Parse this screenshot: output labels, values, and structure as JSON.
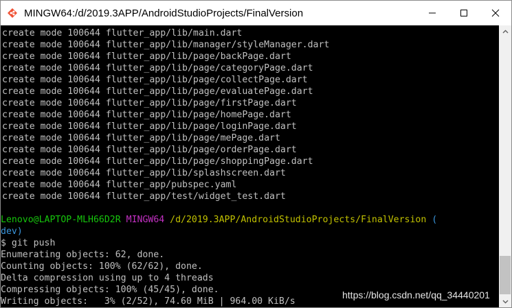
{
  "window": {
    "title": "MINGW64:/d/2019.3APP/AndroidStudioProjects/FinalVersion",
    "icon": "mingw-terminal-icon"
  },
  "controls": {
    "minimize_icon": "minimize-icon",
    "maximize_icon": "maximize-icon",
    "close_icon": "close-icon"
  },
  "terminal": {
    "create_lines": [
      "create mode 100644 flutter_app/lib/main.dart",
      "create mode 100644 flutter_app/lib/manager/styleManager.dart",
      "create mode 100644 flutter_app/lib/page/backPage.dart",
      "create mode 100644 flutter_app/lib/page/categoryPage.dart",
      "create mode 100644 flutter_app/lib/page/collectPage.dart",
      "create mode 100644 flutter_app/lib/page/evaluatePage.dart",
      "create mode 100644 flutter_app/lib/page/firstPage.dart",
      "create mode 100644 flutter_app/lib/page/homePage.dart",
      "create mode 100644 flutter_app/lib/page/loginPage.dart",
      "create mode 100644 flutter_app/lib/page/mePage.dart",
      "create mode 100644 flutter_app/lib/page/orderPage.dart",
      "create mode 100644 flutter_app/lib/page/shoppingPage.dart",
      "create mode 100644 flutter_app/lib/splashscreen.dart",
      "create mode 100644 flutter_app/pubspec.yaml",
      "create mode 100644 flutter_app/test/widget_test.dart"
    ],
    "prompt": {
      "user_host": "Lenovo@LAPTOP-MLH66D2R",
      "env": "MINGW64",
      "path": "/d/2019.3APP/AndroidStudioProjects/FinalVersion",
      "branch_open": "(",
      "branch_rest": "dev)"
    },
    "command": "$ git push",
    "output_lines": [
      "Enumerating objects: 62, done.",
      "Counting objects: 100% (62/62), done.",
      "Delta compression using up to 4 threads",
      "Compressing objects: 100% (45/45), done.",
      "Writing objects:   3% (2/52), 74.60 MiB | 964.00 KiB/s"
    ]
  },
  "colors": {
    "user_host": "#16c60c",
    "env": "#c330c3",
    "path": "#c1c100",
    "branch": "#3a96dd",
    "text": "#c0c0c0"
  },
  "watermark": "https://blog.csdn.net/qq_34440201"
}
